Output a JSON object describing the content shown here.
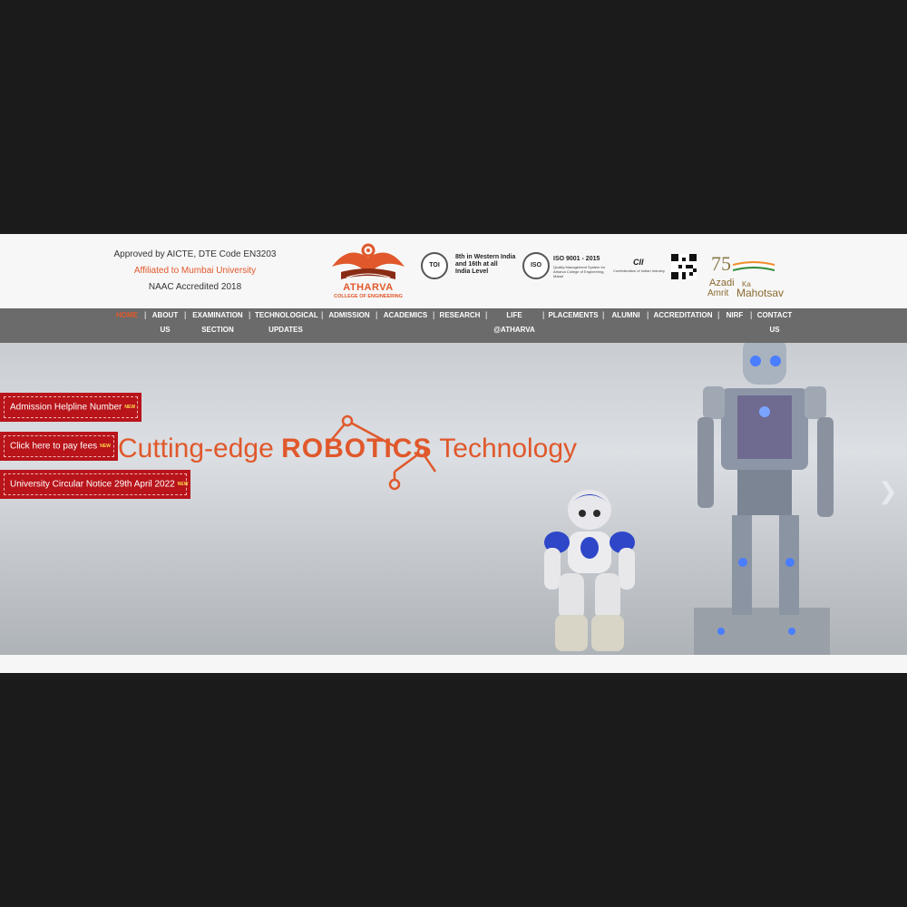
{
  "header": {
    "approval_line": "Approved by AICTE, DTE Code EN3203",
    "affiliation": "Affiliated to Mumbai University",
    "naac": "NAAC Accredited 2018",
    "logo_name": "ATHARVA",
    "logo_sub": "COLLEGE OF ENGINEERING",
    "toi_badge": "TOI",
    "rank_line1": "8th in Western India",
    "rank_line2": "and 16th at all",
    "rank_line3": "India Level",
    "iso_badge": "ISO",
    "iso_title": "ISO 9001 - 2015",
    "iso_desc1": "Quality Management System for",
    "iso_desc2": "Atharva College of Engineering,",
    "iso_desc3": "Malad",
    "cii_logo": "CII",
    "cii_desc": "Confederation of Indian Industry",
    "azadi_number": "75",
    "azadi_word": "Azadi",
    "azadi_ka": "Ka",
    "azadi_amrit": "Amrit",
    "azadi_mahotsav": "Mahotsav"
  },
  "nav": {
    "items": [
      {
        "line1": "HOME",
        "line2": ""
      },
      {
        "line1": "ABOUT",
        "line2": "US"
      },
      {
        "line1": "EXAMINATION",
        "line2": "SECTION"
      },
      {
        "line1": "TECHNOLOGICAL",
        "line2": "UPDATES"
      },
      {
        "line1": "ADMISSION",
        "line2": ""
      },
      {
        "line1": "ACADEMICS",
        "line2": ""
      },
      {
        "line1": "RESEARCH",
        "line2": ""
      },
      {
        "line1": "LIFE",
        "line2": "@ATHARVA"
      },
      {
        "line1": "PLACEMENTS",
        "line2": ""
      },
      {
        "line1": "ALUMNI",
        "line2": ""
      },
      {
        "line1": "ACCREDITATION",
        "line2": ""
      },
      {
        "line1": "NIRF",
        "line2": ""
      },
      {
        "line1": "CONTACT",
        "line2": "US"
      }
    ],
    "separator": "|",
    "active_color": "#e0582b"
  },
  "hero": {
    "headline_left": "Cutting-edge",
    "headline_mid": "ROBOTICS",
    "headline_right": "Technology",
    "next_icon": "chevron-right-icon",
    "accent_color": "#e0582b"
  },
  "side_buttons": [
    {
      "label": "Admission Helpline Number",
      "badge": "NEW"
    },
    {
      "label": "Click here to pay fees",
      "badge": "NEW"
    },
    {
      "label": "University Circular Notice 29th April 2022",
      "badge": "NEW"
    }
  ],
  "colors": {
    "button_red": "#b8141a",
    "nav_bg": "#6b6b6b",
    "outer_bg": "#1c1b1b"
  }
}
